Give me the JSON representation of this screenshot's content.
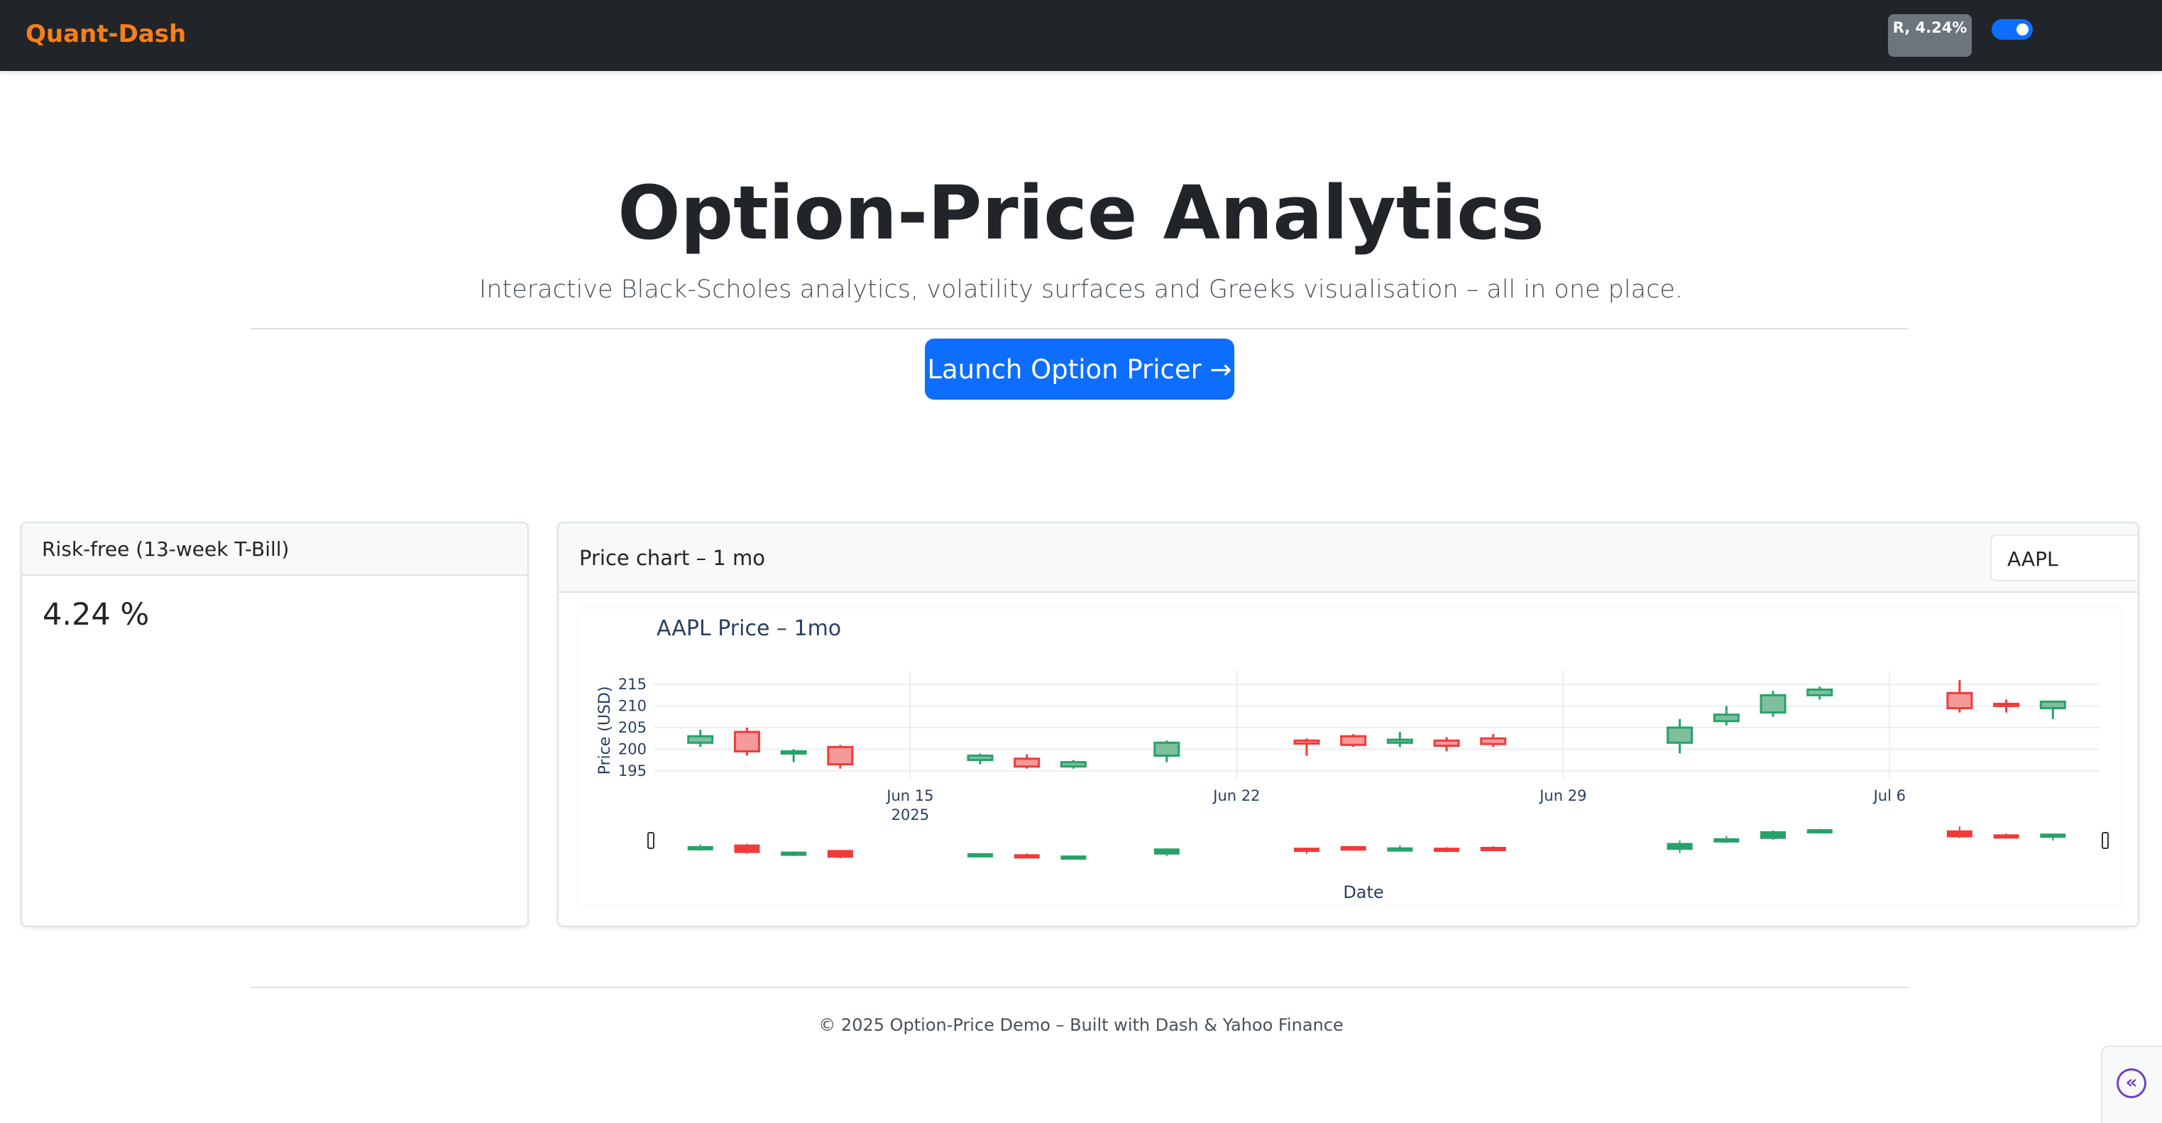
{
  "navbar": {
    "brand": "Quant-Dash",
    "rate_badge": "R, 4.24%",
    "theme_toggle_on": true
  },
  "hero": {
    "title": "Option-Price Analytics",
    "subtitle": "Interactive Black-Scholes analytics, volatility surfaces and Greeks visualisation – all in one place.",
    "launch_button": "Launch Option Pricer →"
  },
  "risk_free_card": {
    "title": "Risk-free (13-week T-Bill)",
    "value": "4.24 %"
  },
  "price_card": {
    "title": "Price chart – 1 mo",
    "ticker_value": "AAPL"
  },
  "footer": {
    "text": "© 2025 Option-Price Demo – Built with Dash & Yahoo Finance"
  },
  "side_button": {
    "icon": "chevron-double-left-icon"
  },
  "colors": {
    "accent": "#0d6efd",
    "brand": "#fd7e14",
    "up": "#26a269",
    "down": "#ef3b3b",
    "navbar": "#212529"
  },
  "chart_data": {
    "type": "candlestick",
    "title": "AAPL Price – 1mo",
    "ylabel": "Price (USD)",
    "xlabel": "Date",
    "ylim": [
      193,
      217
    ],
    "yticks": [
      195,
      200,
      205,
      210,
      215
    ],
    "xticks": [
      {
        "date": "2025-06-15",
        "label": "Jun 15",
        "sublabel": "2025"
      },
      {
        "date": "2025-06-22",
        "label": "Jun 22",
        "sublabel": ""
      },
      {
        "date": "2025-06-29",
        "label": "Jun 29",
        "sublabel": ""
      },
      {
        "date": "2025-07-06",
        "label": "Jul 6",
        "sublabel": ""
      }
    ],
    "xrange": [
      "2025-06-09T12:00",
      "2025-07-10T12:00"
    ],
    "grid": true,
    "range_slider": true,
    "candles": [
      {
        "date": "2025-06-10",
        "open": 201.5,
        "high": 204.5,
        "low": 200.5,
        "close": 203.0
      },
      {
        "date": "2025-06-11",
        "open": 204.0,
        "high": 205.0,
        "low": 198.5,
        "close": 199.5
      },
      {
        "date": "2025-06-12",
        "open": 199.0,
        "high": 200.0,
        "low": 197.0,
        "close": 199.5
      },
      {
        "date": "2025-06-13",
        "open": 200.5,
        "high": 201.0,
        "low": 195.5,
        "close": 196.5
      },
      {
        "date": "2025-06-16",
        "open": 197.5,
        "high": 199.0,
        "low": 196.5,
        "close": 198.5
      },
      {
        "date": "2025-06-17",
        "open": 197.8,
        "high": 198.8,
        "low": 195.5,
        "close": 196.0
      },
      {
        "date": "2025-06-18",
        "open": 196.0,
        "high": 197.5,
        "low": 195.5,
        "close": 197.0
      },
      {
        "date": "2025-06-20",
        "open": 198.5,
        "high": 202.0,
        "low": 197.0,
        "close": 201.5
      },
      {
        "date": "2025-06-23",
        "open": 202.0,
        "high": 202.5,
        "low": 198.5,
        "close": 201.3
      },
      {
        "date": "2025-06-24",
        "open": 203.0,
        "high": 203.5,
        "low": 200.5,
        "close": 201.0
      },
      {
        "date": "2025-06-25",
        "open": 201.5,
        "high": 204.0,
        "low": 200.5,
        "close": 202.2
      },
      {
        "date": "2025-06-26",
        "open": 202.0,
        "high": 202.8,
        "low": 199.5,
        "close": 200.8
      },
      {
        "date": "2025-06-27",
        "open": 202.5,
        "high": 203.5,
        "low": 200.5,
        "close": 201.2
      },
      {
        "date": "2025-07-01",
        "open": 201.5,
        "high": 207.0,
        "low": 199.0,
        "close": 205.0
      },
      {
        "date": "2025-07-02",
        "open": 206.5,
        "high": 210.0,
        "low": 205.5,
        "close": 208.0
      },
      {
        "date": "2025-07-03",
        "open": 208.5,
        "high": 213.5,
        "low": 207.5,
        "close": 212.5
      },
      {
        "date": "2025-07-04",
        "open": 212.5,
        "high": 214.5,
        "low": 211.5,
        "close": 213.8
      },
      {
        "date": "2025-07-07",
        "open": 213.0,
        "high": 216.0,
        "low": 208.5,
        "close": 209.5
      },
      {
        "date": "2025-07-08",
        "open": 210.5,
        "high": 211.5,
        "low": 208.5,
        "close": 210.0
      },
      {
        "date": "2025-07-09",
        "open": 209.5,
        "high": 211.0,
        "low": 207.0,
        "close": 211.0
      }
    ]
  }
}
